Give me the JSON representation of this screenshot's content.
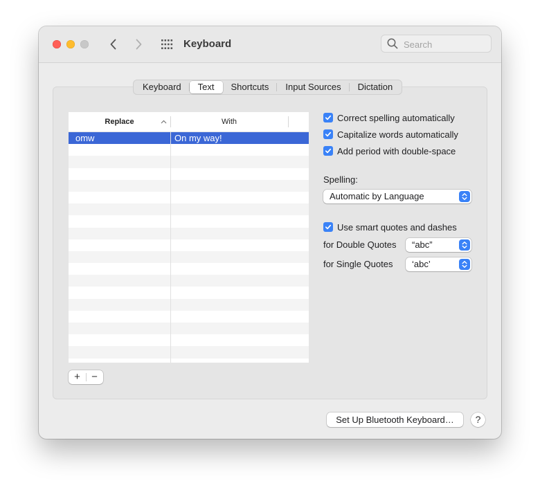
{
  "window": {
    "title": "Keyboard",
    "search_placeholder": "Search"
  },
  "tabs": [
    {
      "label": "Keyboard",
      "active": false
    },
    {
      "label": "Text",
      "active": true
    },
    {
      "label": "Shortcuts",
      "active": false
    },
    {
      "label": "Input Sources",
      "active": false
    },
    {
      "label": "Dictation",
      "active": false
    }
  ],
  "table": {
    "columns": [
      "Replace",
      "With"
    ],
    "rows": [
      {
        "replace": "omw",
        "with": "On my way!",
        "selected": true
      }
    ]
  },
  "controls": {
    "add_label": "+",
    "remove_label": "−"
  },
  "options": {
    "correct_spelling": {
      "label": "Correct spelling automatically",
      "checked": true
    },
    "capitalize_words": {
      "label": "Capitalize words automatically",
      "checked": true
    },
    "add_period": {
      "label": "Add period with double-space",
      "checked": true
    },
    "spelling_label": "Spelling:",
    "spelling_value": "Automatic by Language",
    "smart_quotes": {
      "label": "Use smart quotes and dashes",
      "checked": true
    },
    "double_quotes_label": "for Double Quotes",
    "double_quotes_value": "“abc”",
    "single_quotes_label": "for Single Quotes",
    "single_quotes_value": "‘abc’"
  },
  "footer": {
    "bluetooth_button": "Set Up Bluetooth Keyboard…",
    "help_button": "?"
  },
  "colors": {
    "accent": "#3a82f7",
    "selection": "#3b67d6",
    "close": "#ff5f57",
    "minimize": "#febc2e"
  }
}
